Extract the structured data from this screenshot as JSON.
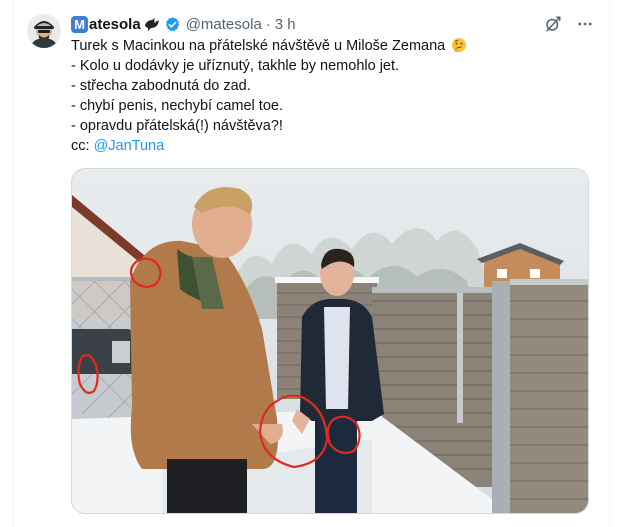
{
  "author": {
    "logo_letter": "M",
    "display_name": "atesola",
    "handle": "@matesola",
    "time": "3 h"
  },
  "icons": {
    "bird": "bird-emoji-icon",
    "verified": "verified-badge-icon",
    "grok": "grok-icon",
    "more": "more-icon",
    "thinking": "thinking-face-emoji"
  },
  "tweet": {
    "lines": [
      "Turek s Macinkou na přátelské návštěvě u Miloše Zemana",
      "- Kolo u dodávky je uříznutý, takhle by nemohlo jet.",
      "- střecha zabodnutá do zad.",
      "- chybí penis, nechybí camel toe.",
      "- opravdu přátelská(!) návštěva?!"
    ],
    "cc_label": "cc:",
    "cc_mention": "@JanTuna"
  },
  "colors": {
    "accent": "#1d9bf0",
    "verified": "#1d9bf0",
    "annotation": "#e02a1f"
  }
}
